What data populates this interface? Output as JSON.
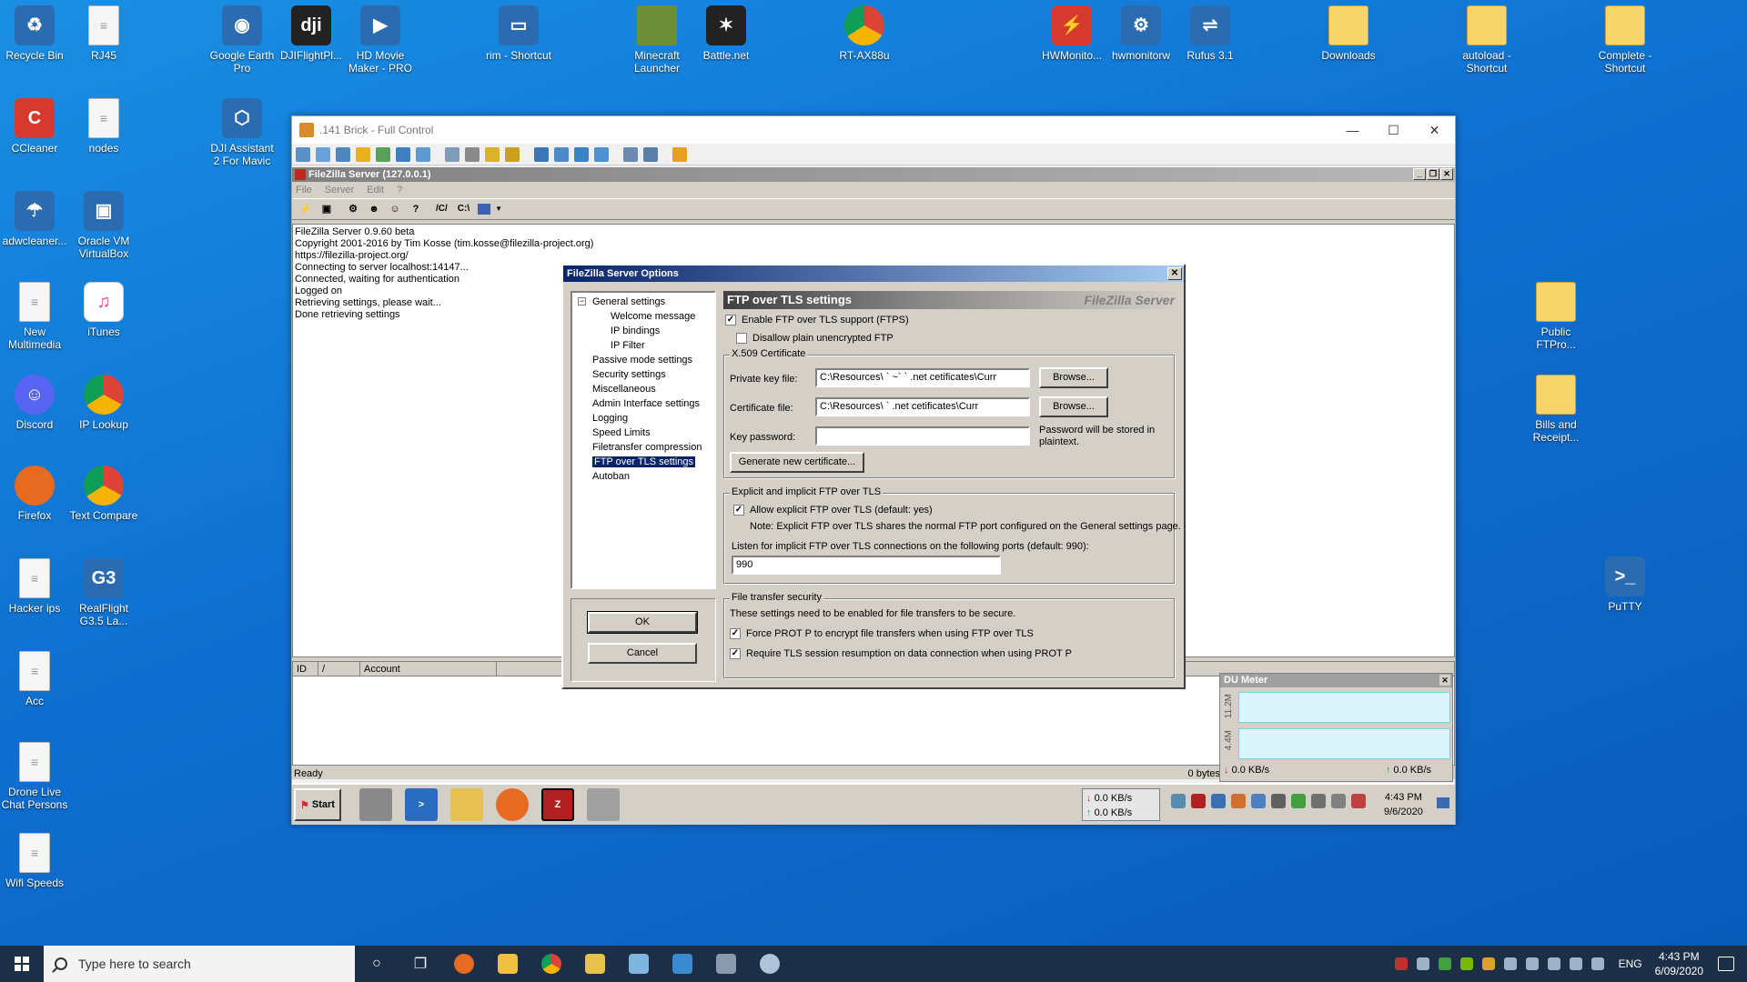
{
  "desktop": {
    "icons": [
      {
        "label": "Recycle Bin",
        "glyph": "recycle-bin-icon"
      },
      {
        "label": "RJ45",
        "glyph": "document-icon"
      },
      {
        "label": "Google Earth Pro",
        "glyph": "google-earth-icon"
      },
      {
        "label": "DJIFlightPl...",
        "glyph": "dji-icon"
      },
      {
        "label": "HD Movie Maker - PRO",
        "glyph": "movie-maker-icon"
      },
      {
        "label": "rim - Shortcut",
        "glyph": "shortcut-icon"
      },
      {
        "label": "Minecraft Launcher",
        "glyph": "minecraft-icon"
      },
      {
        "label": "Battle.net",
        "glyph": "battlenet-icon"
      },
      {
        "label": "RT-AX88u",
        "glyph": "chrome-icon"
      },
      {
        "label": "HWMonito...",
        "glyph": "hwmonitor-icon"
      },
      {
        "label": "hwmonitorw",
        "glyph": "gear-icon"
      },
      {
        "label": "Rufus 3.1",
        "glyph": "usb-icon"
      },
      {
        "label": "Downloads",
        "glyph": "folder-icon"
      },
      {
        "label": "autoload - Shortcut",
        "glyph": "folder-icon"
      },
      {
        "label": "Complete - Shortcut",
        "glyph": "folder-icon"
      },
      {
        "label": "CCleaner",
        "glyph": "ccleaner-icon"
      },
      {
        "label": "nodes",
        "glyph": "document-icon"
      },
      {
        "label": "DJI Assistant 2 For Mavic",
        "glyph": "dji-assistant-icon"
      },
      {
        "label": "adwcleaner...",
        "glyph": "adwcleaner-icon"
      },
      {
        "label": "Oracle VM VirtualBox",
        "glyph": "virtualbox-icon"
      },
      {
        "label": "New Multimedia",
        "glyph": "document-icon"
      },
      {
        "label": "iTunes",
        "glyph": "itunes-icon"
      },
      {
        "label": "Discord",
        "glyph": "discord-icon"
      },
      {
        "label": "IP Lookup",
        "glyph": "chrome-icon"
      },
      {
        "label": "Firefox",
        "glyph": "firefox-icon"
      },
      {
        "label": "Text Compare",
        "glyph": "chrome-icon"
      },
      {
        "label": "Hacker ips",
        "glyph": "document-icon"
      },
      {
        "label": "RealFlight G3.5 La...",
        "glyph": "realflight-icon"
      },
      {
        "label": "Acc",
        "glyph": "document-icon"
      },
      {
        "label": "Drone Live Chat Persons",
        "glyph": "document-icon"
      },
      {
        "label": "Wifi Speeds",
        "glyph": "document-icon"
      },
      {
        "label": "Public FTPro...",
        "glyph": "folder-icon"
      },
      {
        "label": "Bills and Receipt...",
        "glyph": "folder-icon"
      },
      {
        "label": "PuTTY",
        "glyph": "putty-icon"
      }
    ]
  },
  "remote": {
    "title": ".141 Brick - Full Control"
  },
  "filezilla": {
    "title": "FileZilla Server (127.0.0.1)",
    "menu": [
      "File",
      "Server",
      "Edit",
      "?"
    ],
    "toolbar_paths": [
      "/C/",
      "C:\\"
    ],
    "log": [
      "FileZilla Server 0.9.60 beta",
      "Copyright 2001-2016 by Tim Kosse (tim.kosse@filezilla-project.org)",
      "https://filezilla-project.org/",
      "Connecting to server localhost:14147...",
      "Connected, waiting for authentication",
      "Logged on",
      "Retrieving settings, please wait...",
      "Done retrieving settings"
    ],
    "list_headers": [
      "ID",
      "/",
      "Account"
    ],
    "status_left": "Ready",
    "status_right": "0 bytes"
  },
  "options_dialog": {
    "title": "FileZilla Server Options",
    "tree": [
      {
        "label": "General settings",
        "level": 0,
        "expander": "−"
      },
      {
        "label": "Welcome message",
        "level": 1
      },
      {
        "label": "IP bindings",
        "level": 1
      },
      {
        "label": "IP Filter",
        "level": 1
      },
      {
        "label": "Passive mode settings",
        "level": 0
      },
      {
        "label": "Security settings",
        "level": 0
      },
      {
        "label": "Miscellaneous",
        "level": 0
      },
      {
        "label": "Admin Interface settings",
        "level": 0
      },
      {
        "label": "Logging",
        "level": 0
      },
      {
        "label": "Speed Limits",
        "level": 0
      },
      {
        "label": "Filetransfer compression",
        "level": 0
      },
      {
        "label": "FTP over TLS settings",
        "level": 0,
        "selected": true
      },
      {
        "label": "Autoban",
        "level": 0
      }
    ],
    "ok_label": "OK",
    "cancel_label": "Cancel",
    "panel_title": "FTP over TLS settings",
    "brand": "FileZilla Server",
    "enable_tls": {
      "label": "Enable FTP over TLS support (FTPS)",
      "checked": true
    },
    "disallow_plain": {
      "label": "Disallow plain unencrypted FTP",
      "checked": false
    },
    "x509": {
      "legend": "X.509 Certificate",
      "private_key_label": "Private key file:",
      "private_key_value": "C:\\Resources\\     ` ~` `  .net cetificates\\Curr",
      "certificate_label": "Certificate file:",
      "certificate_value": "C:\\Resources\\          `  .net cetificates\\Curr",
      "browse_label": "Browse...",
      "key_password_label": "Key password:",
      "key_password_value": "",
      "password_note": "Password will be stored in plaintext.",
      "generate_label": "Generate new certificate..."
    },
    "explicit": {
      "legend": "Explicit and implicit FTP over TLS",
      "allow_explicit": {
        "label": "Allow explicit FTP over TLS (default: yes)",
        "checked": true
      },
      "note": "Note: Explicit FTP over TLS shares the normal FTP port configured on the General settings page.",
      "implicit_label": "Listen for implicit FTP over TLS connections on the following ports (default: 990):",
      "implicit_ports": "990"
    },
    "transfer_security": {
      "legend": "File transfer security",
      "description": "These settings need to be enabled for file transfers to be secure.",
      "force_prot_p": {
        "label": "Force PROT P to encrypt file transfers when using FTP over TLS",
        "checked": true
      },
      "require_resumption": {
        "label": "Require TLS session resumption on data connection when using PROT P",
        "checked": true
      }
    }
  },
  "du_meter": {
    "title": "DU Meter",
    "scale_top": "11.2M",
    "scale_bottom": "4.4M",
    "down_rate": "0.0 KB/s",
    "up_rate": "0.0 KB/s"
  },
  "remote_taskbar": {
    "start_label": "Start",
    "down_speed": "0.0 KB/s",
    "up_speed": "0.0 KB/s",
    "time": "4:43 PM",
    "date": "9/6/2020"
  },
  "taskbar": {
    "search_placeholder": "Type here to search",
    "language": "ENG",
    "time": "4:43 PM",
    "date": "6/09/2020"
  }
}
